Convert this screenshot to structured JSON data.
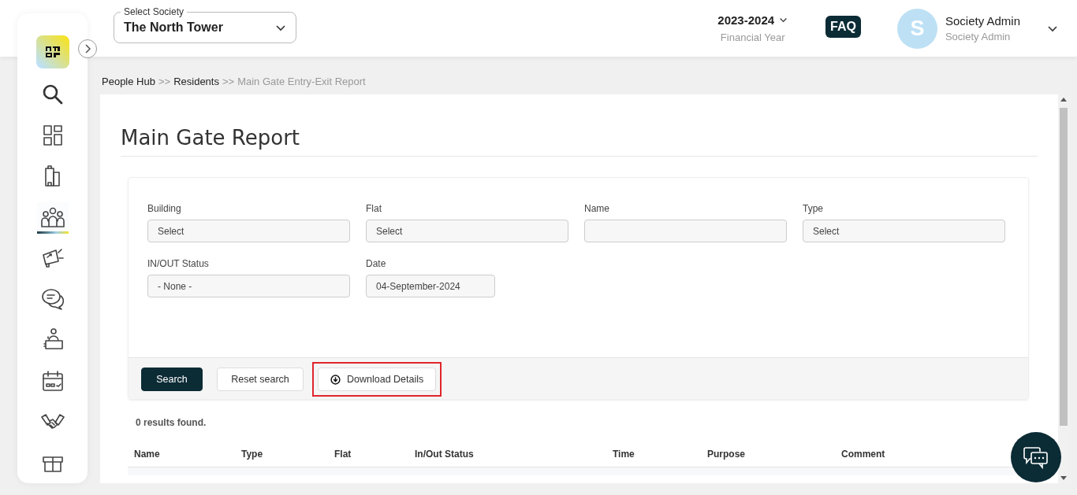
{
  "sidebar": {
    "logo": {
      "kind": "logo"
    },
    "items": [
      {
        "kind": "search",
        "selected": false
      },
      {
        "kind": "dashboard",
        "selected": false
      },
      {
        "kind": "building",
        "selected": false
      },
      {
        "kind": "people",
        "selected": true
      },
      {
        "kind": "megaphone",
        "selected": false
      },
      {
        "kind": "chat",
        "selected": false
      },
      {
        "kind": "desk",
        "selected": false
      },
      {
        "kind": "calendar",
        "selected": false
      },
      {
        "kind": "handshake",
        "selected": false
      },
      {
        "kind": "box",
        "selected": false
      }
    ]
  },
  "header": {
    "society": {
      "label": "Select Society",
      "value": "The North Tower"
    },
    "year": {
      "value": "2023-2024",
      "label": "Financial Year"
    },
    "faq": "FAQ",
    "user": {
      "initial": "S",
      "name": "Society Admin",
      "role": "Society Admin"
    }
  },
  "breadcrumb": [
    {
      "label": "People Hub",
      "current": false
    },
    {
      "label": ">>",
      "kind": "sep"
    },
    {
      "label": "Residents",
      "current": false
    },
    {
      "label": ">>",
      "kind": "sep"
    },
    {
      "label": "Main Gate Entry-Exit Report",
      "current": true
    }
  ],
  "page_title": "Main Gate Report",
  "filters": [
    {
      "label": "Building",
      "value": "Select",
      "kind": "select"
    },
    {
      "label": "Flat",
      "value": "Select",
      "kind": "select"
    },
    {
      "label": "Name",
      "kind": "text"
    },
    {
      "label": "Type",
      "value": "Select",
      "kind": "select"
    },
    {
      "label": "IN/OUT Status",
      "value": "- None -",
      "kind": "select"
    },
    {
      "label": "Date",
      "value": "04-September-2024",
      "kind": "date"
    }
  ],
  "buttons": [
    {
      "label": "Search",
      "kind": "primary",
      "highlighted": false
    },
    {
      "label": "Reset search",
      "kind": "plain",
      "highlighted": false
    },
    {
      "label": "Download Details",
      "kind": "download",
      "highlighted": true
    }
  ],
  "results_text": "0 results found.",
  "table": {
    "columns": [
      "Name",
      "Type",
      "Flat",
      "In/Out Status",
      "Time",
      "Purpose",
      "Comment"
    ]
  }
}
